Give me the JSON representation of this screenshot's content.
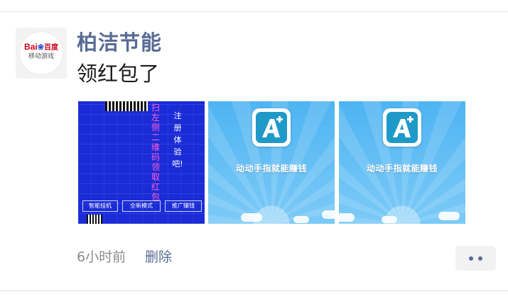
{
  "post": {
    "username": "柏洁节能",
    "text": "领红包了",
    "timestamp": "6小时前",
    "delete_label": "删除",
    "avatar": {
      "brand_en": "Bai",
      "brand_cn": "百度",
      "subtitle": "移动游戏",
      "icon": "baidu-paw-icon"
    },
    "images": [
      {
        "type": "promo-poster",
        "text_left": "扫左侧二维码领取红包",
        "text_right": "注册体验吧!",
        "buttons": [
          "智能挂机",
          "全新模式",
          "推广赚钱"
        ]
      },
      {
        "type": "app-card",
        "caption": "动动手指就能赚钱",
        "icon": "a-plus-app-icon"
      },
      {
        "type": "app-card",
        "caption": "动动手指就能赚钱",
        "icon": "a-plus-app-icon"
      }
    ],
    "more_icon": "more-dots-icon"
  },
  "colors": {
    "username": "#586b95",
    "link": "#586b95",
    "timestamp": "#8a8a8a",
    "poster_bg": "#1b2bd6",
    "card_bg": "#56b8f2"
  }
}
